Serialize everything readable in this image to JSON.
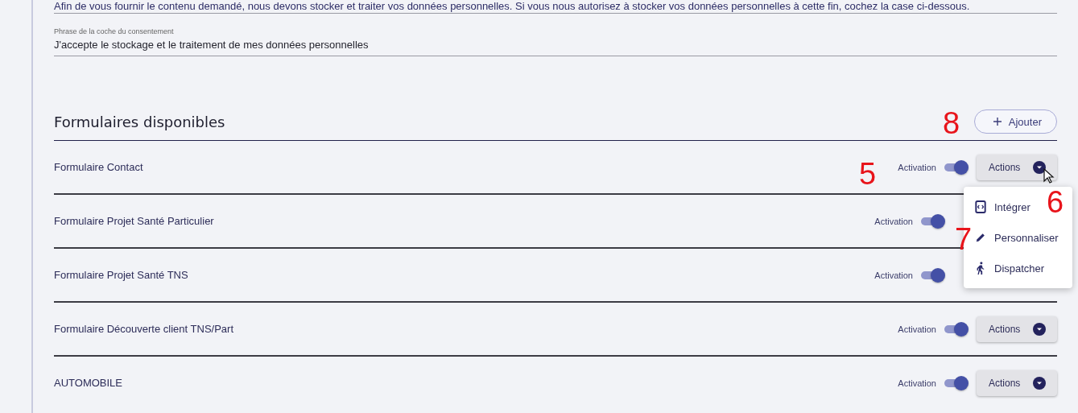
{
  "consent": {
    "intro_text": "Afin de vous fournir le contenu demandé, nous devons stocker et traiter vos données personnelles. Si vous nous autorisez à stocker vos données personnelles à cette fin, cochez la case ci-dessous.",
    "checkbox_phrase_label": "Phrase de la coche du consentement",
    "checkbox_phrase_value": "J'accepte le stockage et le traitement de mes données personnelles"
  },
  "forms_section": {
    "title": "Formulaires disponibles",
    "add_button": "Ajouter",
    "rows": [
      {
        "name": "Formulaire Contact",
        "toggle_label": "Activation",
        "on": true,
        "actions": "Actions"
      },
      {
        "name": "Formulaire Projet Santé Particulier",
        "toggle_label": "Activation",
        "on": true
      },
      {
        "name": "Formulaire Projet Santé TNS",
        "toggle_label": "Activation",
        "on": true
      },
      {
        "name": "Formulaire Découverte client TNS/Part",
        "toggle_label": "Activation",
        "on": true,
        "actions": "Actions"
      },
      {
        "name": "AUTOMOBILE",
        "toggle_label": "Activation",
        "on": true,
        "actions": "Actions"
      }
    ]
  },
  "actions_menu": [
    {
      "kind": "embed",
      "label": "Intégrer"
    },
    {
      "kind": "edit",
      "label": "Personnaliser"
    },
    {
      "kind": "walk",
      "label": "Dispatcher"
    }
  ],
  "annotations": [
    "8",
    "5",
    "6",
    "7"
  ]
}
